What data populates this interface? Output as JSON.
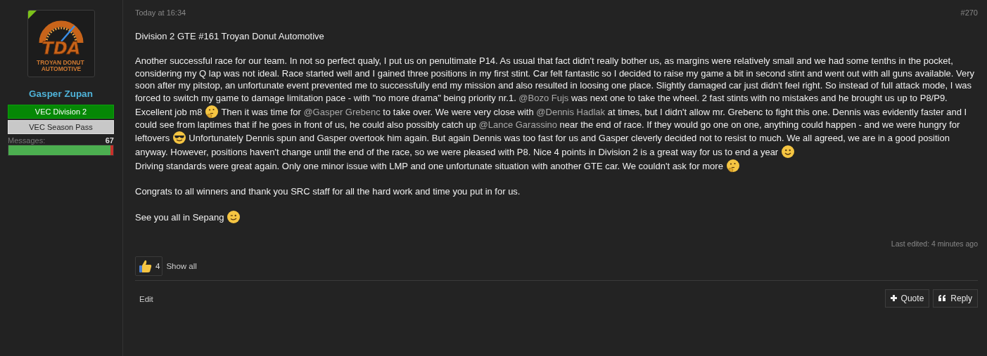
{
  "author": {
    "online": true,
    "logo_text": "TDA",
    "logo_subtitle": "TROYAN DONUT AUTOMOTIVE",
    "name": "Gasper Zupan",
    "banners": [
      {
        "label": "VEC Division 2",
        "kind": "primary"
      },
      {
        "label": "VEC Season Pass",
        "kind": "secondary"
      }
    ],
    "stats": {
      "label": "Messages:",
      "value": "67",
      "level": 0.97
    }
  },
  "post": {
    "time": "Today at 16:34",
    "number": "#270",
    "paragraphs": [
      {
        "gap": false,
        "segments": [
          {
            "kind": "text",
            "text": "Division 2 GTE #161 Troyan Donut Automotive"
          }
        ]
      },
      {
        "gap": true,
        "segments": [
          {
            "kind": "text",
            "text": "Another successful race for our team. In not so perfect qualy, I put us on penultimate P14. As usual that fact didn't really bother us, as margins were relatively small and we had some tenths in the pocket, considering my Q lap was not ideal. Race started well and I gained three positions in my first stint. Car felt fantastic so I decided to raise my game a bit in second stint and went out with all guns available. Very soon after my pitstop, an unfortunate event prevented me to successfully end my mission and also resulted in loosing one place. Slightly damaged car just didn't feel right. So instead of full attack mode, I was forced to switch my game to damage limitation pace - with \"no more drama\" being priority nr.1. "
          },
          {
            "kind": "mention",
            "text": "@Bozo Fujs"
          },
          {
            "kind": "text",
            "text": " was next one to take the wheel. 2 fast stints with no mistakes and he brought us up to P8/P9. Excellent job m8 "
          },
          {
            "kind": "thinking"
          },
          {
            "kind": "text",
            "text": " Then it was time for "
          },
          {
            "kind": "mention",
            "text": "@Gasper Grebenc"
          },
          {
            "kind": "text",
            "text": " to take over. We were very close with "
          },
          {
            "kind": "mention",
            "text": "@Dennis Hadlak"
          },
          {
            "kind": "text",
            "text": " at times, but I didn't allow mr. Grebenc to fight this one. Dennis was evidently faster and I could see from laptimes that if he goes in front of us, he could also possibly catch up "
          },
          {
            "kind": "mention",
            "text": "@Lance Garassino"
          },
          {
            "kind": "text",
            "text": " near the end of race. If they would go one on one, anything could happen - and we were hungry for leftovers "
          },
          {
            "kind": "cool"
          },
          {
            "kind": "text",
            "text": " Unfortunately Dennis spun and Gasper overtook him again. But again Dennis was too fast for us and Gasper cleverly decided not to resist to much. We all agreed, we are in a good position anyway. However, positions haven't change until the end of the race, so we were pleased with P8. Nice 4 points in Division 2 is a great way for us to end a year "
          },
          {
            "kind": "smile"
          }
        ]
      },
      {
        "gap": false,
        "segments": [
          {
            "kind": "text",
            "text": "Driving standards were great again. Only one minor issue with LMP and one unfortunate situation with another GTE car. We couldn't ask for more "
          },
          {
            "kind": "thinking"
          }
        ]
      },
      {
        "gap": true,
        "segments": [
          {
            "kind": "text",
            "text": "Congrats to all winners and thank you SRC staff for all the hard work and time you put in for us."
          }
        ]
      },
      {
        "gap": true,
        "segments": [
          {
            "kind": "text",
            "text": "See you all in Sepang "
          },
          {
            "kind": "wink"
          }
        ]
      }
    ],
    "last_edited": "Last edited: 4 minutes ago",
    "reactions": {
      "count": "4",
      "show_all": "Show all"
    },
    "actions": [
      {
        "label": "Edit",
        "kind": "plain"
      }
    ],
    "buttons": [
      {
        "label": "Quote",
        "kind": "quote"
      },
      {
        "label": "Reply",
        "kind": "reply"
      }
    ]
  }
}
